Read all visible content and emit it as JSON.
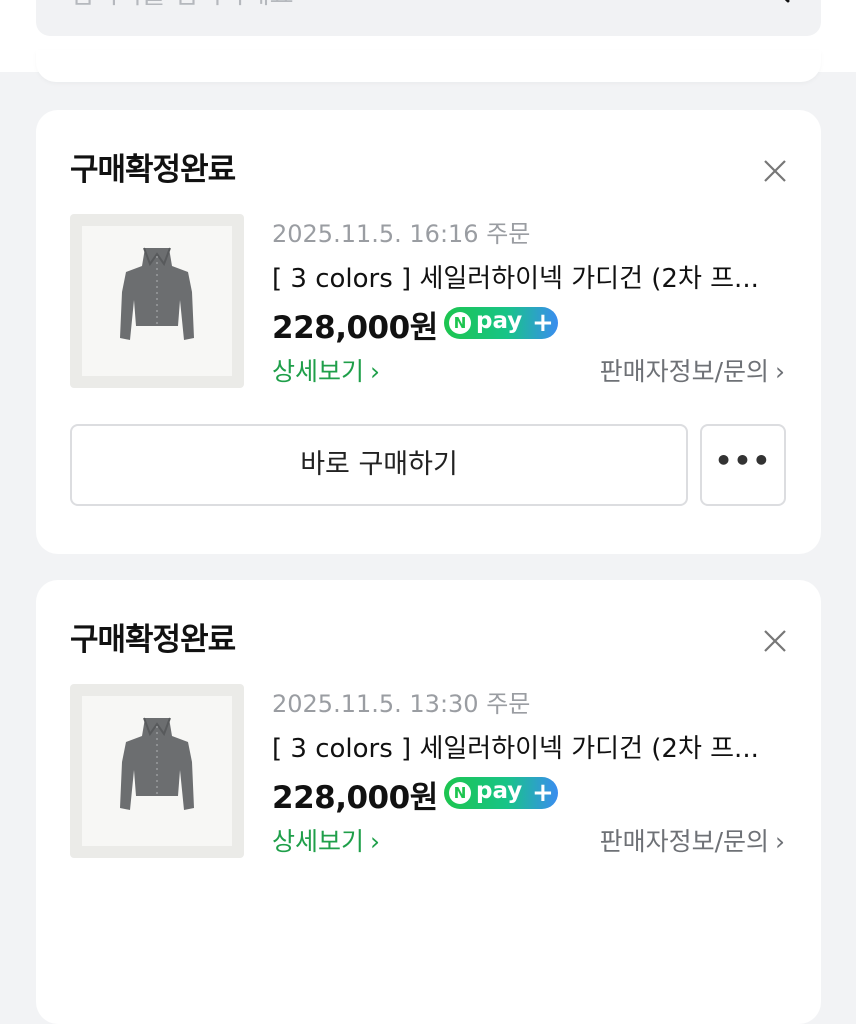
{
  "search": {
    "placeholder": "검색어를 입력하세요"
  },
  "orders": [
    {
      "status": "구매확정완료",
      "order_date": "2025.11.5. 16:16 주문",
      "product_name": "[ 3 colors ] 세일러하이넥 가디건 (2차 프...",
      "price": "228,000원",
      "npay_label": "pay",
      "detail_link": "상세보기",
      "seller_link": "판매자정보/문의",
      "buy_button": "바로 구매하기",
      "more_button": "•••",
      "thumbnail_icon": "cardigan-image"
    },
    {
      "status": "구매확정완료",
      "order_date": "2025.11.5. 13:30 주문",
      "product_name": "[ 3 colors ] 세일러하이넥 가디건 (2차 프...",
      "price": "228,000원",
      "npay_label": "pay",
      "detail_link": "상세보기",
      "seller_link": "판매자정보/문의",
      "thumbnail_icon": "cardigan-image"
    }
  ],
  "colors": {
    "background": "#f2f3f5",
    "card": "#ffffff",
    "link_green": "#1f9f4a",
    "npay_green": "#1dc54f",
    "npay_blue": "#3a8cf0",
    "muted_text": "#9a9da2"
  }
}
